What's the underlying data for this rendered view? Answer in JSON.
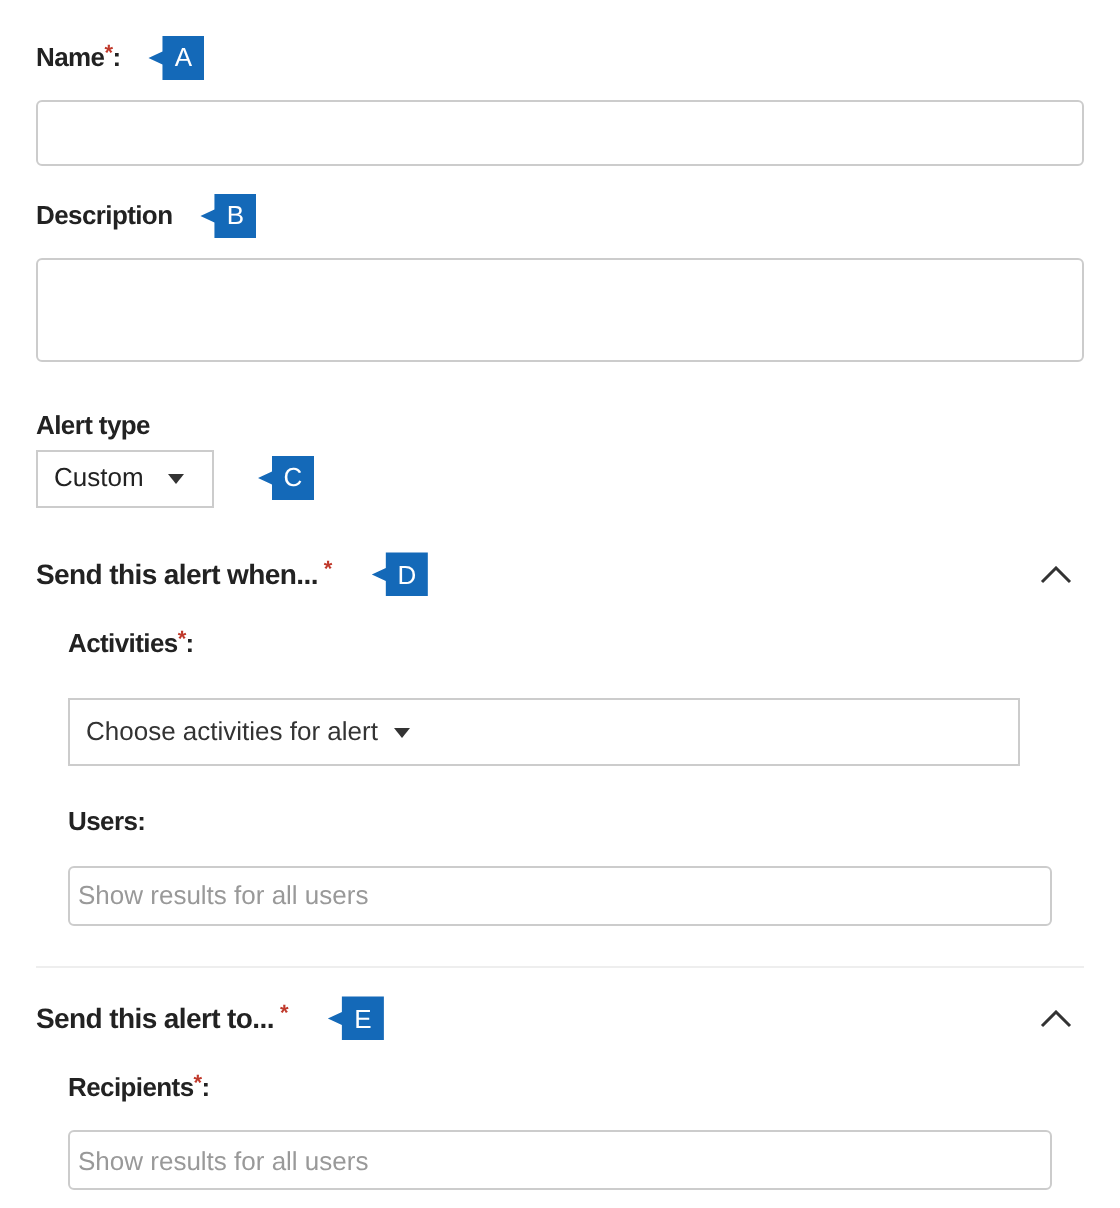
{
  "fields": [
    {
      "kind": "text",
      "label": "Name",
      "mark": "*",
      "suffix": ":",
      "callout": "A"
    },
    {
      "kind": "textarea",
      "label": "Description",
      "callout": "B"
    },
    {
      "kind": "dropdown",
      "label": "Alert type",
      "value": "Custom",
      "callout": "C"
    }
  ],
  "sections": [
    {
      "title": "Send this alert when...",
      "mark": "*",
      "callout": "D",
      "expanded": true,
      "fields": [
        {
          "kind": "wide-dropdown",
          "label": "Activities",
          "mark": "*",
          "suffix": ":",
          "value": "Choose activities for alert"
        },
        {
          "kind": "search",
          "label": "Users",
          "suffix": ":",
          "placeholder": "Show results for all users"
        }
      ]
    },
    {
      "title": "Send this alert to...",
      "mark": "*",
      "callout": "E",
      "expanded": true,
      "fields": [
        {
          "kind": "search",
          "label": "Recipients",
          "mark": "*",
          "suffix": ":",
          "placeholder": "Show results for all users"
        }
      ]
    }
  ]
}
